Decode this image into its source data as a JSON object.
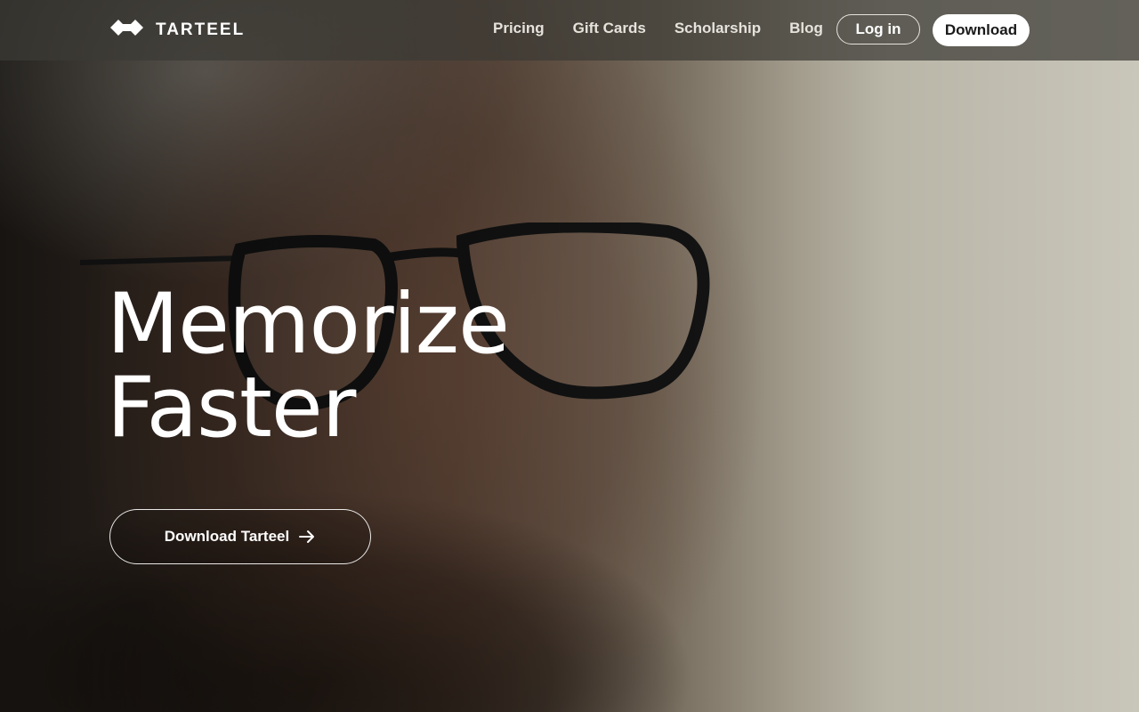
{
  "header": {
    "logo_text": "TARTEEL",
    "logo_icon": "tarteel-logo-icon",
    "nav": [
      {
        "label": "Pricing"
      },
      {
        "label": "Gift Cards"
      },
      {
        "label": "Scholarship"
      },
      {
        "label": "Blog"
      }
    ],
    "login_label": "Log in",
    "download_label": "Download"
  },
  "hero": {
    "title_line1": "Memorize",
    "title_line2": "Faster",
    "cta_label": "Download Tarteel",
    "cta_icon": "arrow-right-icon"
  },
  "colors": {
    "header_bg": "#3c3a34",
    "text": "#ffffff",
    "download_bg": "#ffffff"
  }
}
